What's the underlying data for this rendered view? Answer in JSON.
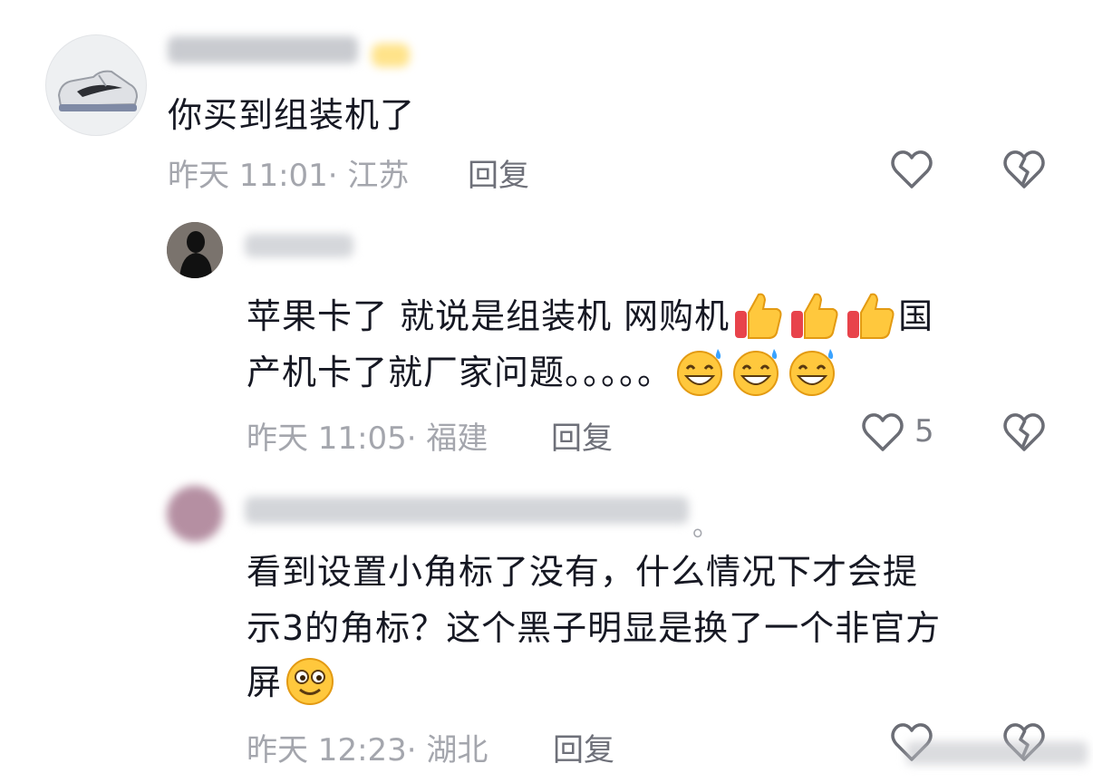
{
  "comments": [
    {
      "text": "你买到组装机了",
      "time": "昨天 11:01· 江苏",
      "reply_label": "回复"
    },
    {
      "line1": "苹果卡了  就说是组装机  网购机",
      "line1_tail": "国",
      "line2": "产机卡了就厂家问题。。。。。",
      "time": "昨天 11:05· 福建",
      "reply_label": "回复",
      "like_count": "5"
    },
    {
      "tail_dot": "。",
      "line1": "看到设置小角标了没有，什么情况下才会提",
      "line2": "示3的角标？这个黑子明显是换了一个非官方",
      "line3": "屏",
      "time": "昨天 12:23· 湖北",
      "reply_label": "回复"
    }
  ],
  "icons": {
    "like": "heart-outline-icon",
    "dislike": "broken-heart-icon",
    "thumbs_up": "thumbs-up-emoji",
    "grin_sweat": "grinning-sweat-emoji",
    "smile": "smiling-emoji"
  },
  "colors": {
    "text": "#161823",
    "meta": "#a4a6ad",
    "reply": "#6e7079",
    "icon": "#6b6d75",
    "emoji_yellow": "#ffc83d",
    "emoji_red": "#e8434b"
  }
}
